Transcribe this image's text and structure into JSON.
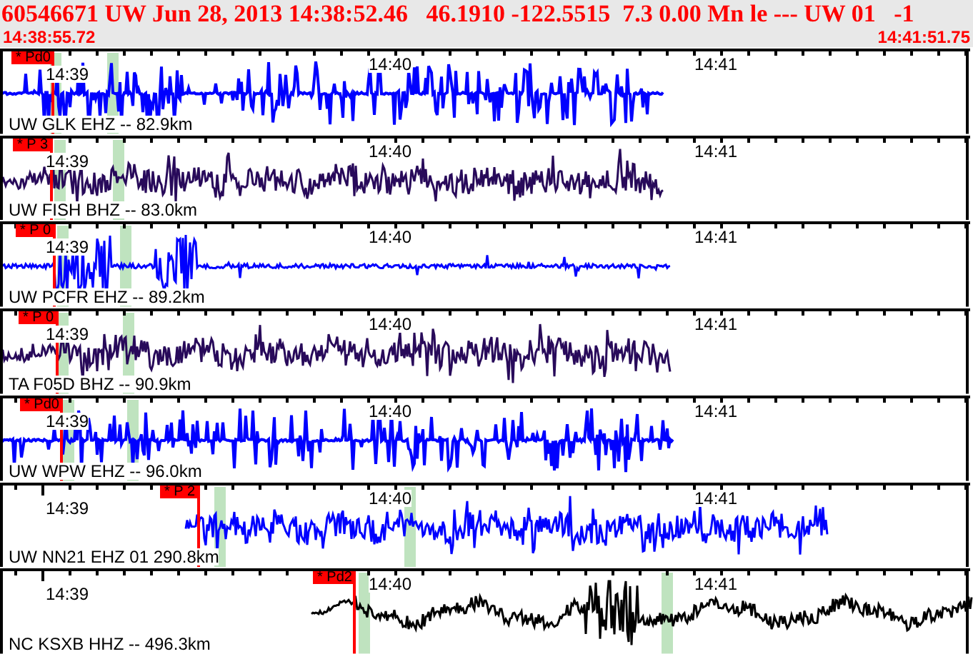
{
  "header": {
    "event": "60546671 UW Jun 28, 2013 14:38:52.46   46.1910 -122.5515  7.3 0.00 Mn le --- UW 01   -1",
    "start_time": "14:38:55.72",
    "end_time": "14:41:51.75"
  },
  "traces": [
    {
      "station": "UW GLK EHZ -- 82.9km",
      "pick": "* Pd0",
      "color": "#0000ff",
      "kind": "spiky",
      "times": [
        "14:39",
        "14:40",
        "14:41"
      ]
    },
    {
      "station": "UW FISH BHZ -- 83.0km",
      "pick": "* P 3",
      "color": "#280a5a",
      "kind": "noisy",
      "times": [
        "14:39",
        "14:40",
        "14:41"
      ]
    },
    {
      "station": "UW PCFR EHZ -- 89.2km",
      "pick": "* P 0",
      "color": "#0000ff",
      "kind": "burst",
      "times": [
        "14:39",
        "14:40",
        "14:41"
      ]
    },
    {
      "station": "TA F05D BHZ -- 90.9km",
      "pick": "* P 0",
      "color": "#280a5a",
      "kind": "noisy",
      "times": [
        "14:39",
        "14:40",
        "14:41"
      ]
    },
    {
      "station": "UW WPW EHZ -- 96.0km",
      "pick": "* Pd0",
      "color": "#0000ff",
      "kind": "spiky",
      "times": [
        "14:39",
        "14:40",
        "14:41"
      ]
    },
    {
      "station": "UW NN21 EHZ 01 290.8km",
      "pick": "* P 2",
      "color": "#0000ff",
      "kind": "noisy",
      "times": [
        "14:39",
        "14:40",
        "14:41"
      ]
    },
    {
      "station": "NC KSXB HHZ -- 496.3km",
      "pick": "* Pd2",
      "color": "#000000",
      "kind": "wavy",
      "times": [
        "14:39",
        "14:40",
        "14:41"
      ]
    }
  ]
}
